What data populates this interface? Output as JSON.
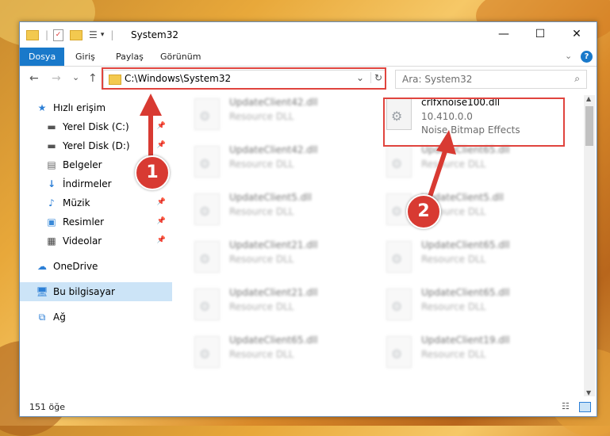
{
  "window": {
    "title": "System32"
  },
  "titlebar": {
    "minimize": "—",
    "maximize": "☐",
    "close": "✕"
  },
  "ribbon": {
    "tabs": [
      "Dosya",
      "Giriş",
      "Paylaş",
      "Görünüm"
    ],
    "active": "Dosya",
    "help": "?"
  },
  "navbar": {
    "path": "C:\\Windows\\System32",
    "search_placeholder": "Ara: System32",
    "back": "←",
    "forward": "→",
    "recent": "⌄",
    "up": "↑",
    "refresh": "↻",
    "dropdown": "⌄"
  },
  "sidebar": {
    "items": [
      {
        "label": "Hızlı erişim",
        "icon": "star-icon"
      },
      {
        "label": "Yerel Disk (C:)",
        "icon": "drive-icon"
      },
      {
        "label": "Yerel Disk (D:)",
        "icon": "drive-icon"
      },
      {
        "label": "Belgeler",
        "icon": "document-icon"
      },
      {
        "label": "İndirmeler",
        "icon": "download-icon"
      },
      {
        "label": "Müzik",
        "icon": "music-icon"
      },
      {
        "label": "Resimler",
        "icon": "picture-icon"
      },
      {
        "label": "Videolar",
        "icon": "video-icon"
      },
      {
        "label": "OneDrive",
        "icon": "cloud-icon"
      },
      {
        "label": "Bu bilgisayar",
        "icon": "computer-icon"
      },
      {
        "label": "Ağ",
        "icon": "network-icon"
      }
    ]
  },
  "files": [
    {
      "name": "UpdateClient42.dll",
      "desc": "Resource DLL"
    },
    {
      "name": "crlfxnoise100.dll",
      "desc": "10.410.0.0",
      "desc2": "Noise Bitmap Effects"
    },
    {
      "name": "UpdateClient42.dll",
      "desc": "Resource DLL"
    },
    {
      "name": "UpdateClient65.dll",
      "desc": "Resource DLL"
    },
    {
      "name": "UpdateClient5.dll",
      "desc": "Resource DLL"
    },
    {
      "name": "UpdateClient5.dll",
      "desc": "Resource DLL"
    },
    {
      "name": "UpdateClient21.dll",
      "desc": "Resource DLL"
    },
    {
      "name": "UpdateClient65.dll",
      "desc": "Resource DLL"
    },
    {
      "name": "UpdateClient21.dll",
      "desc": "Resource DLL"
    },
    {
      "name": "UpdateClient65.dll",
      "desc": "Resource DLL"
    },
    {
      "name": "UpdateClient65.dll",
      "desc": "Resource DLL"
    },
    {
      "name": "UpdateClient19.dll",
      "desc": "Resource DLL"
    }
  ],
  "status": {
    "count": "151 öğe"
  },
  "annotations": {
    "badge1": "1",
    "badge2": "2"
  },
  "colors": {
    "accent": "#1979ca",
    "highlight": "#e0443e"
  }
}
